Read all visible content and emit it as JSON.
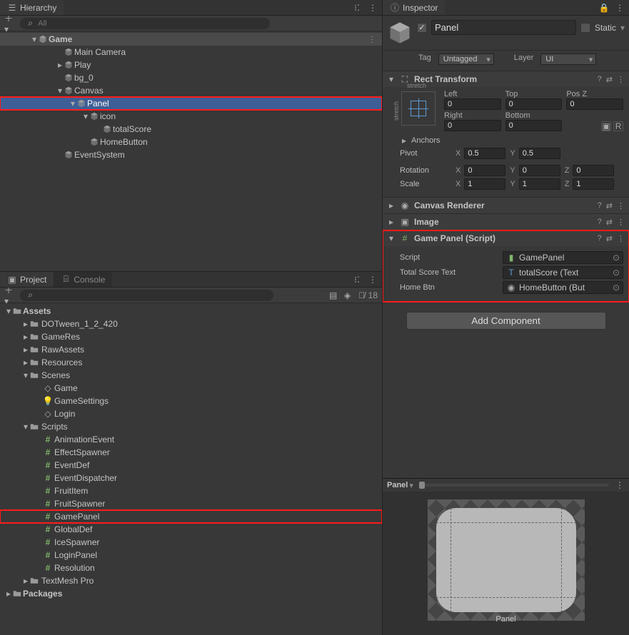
{
  "hierarchy": {
    "tab": "Hierarchy",
    "search_placeholder": "All",
    "scene": "Game",
    "items": [
      {
        "name": "Main Camera",
        "depth": 2,
        "fold": ""
      },
      {
        "name": "Play",
        "depth": 2,
        "fold": "▸"
      },
      {
        "name": "bg_0",
        "depth": 2,
        "fold": ""
      },
      {
        "name": "Canvas",
        "depth": 2,
        "fold": "▾"
      },
      {
        "name": "Panel",
        "depth": 3,
        "fold": "▾",
        "selected": true,
        "highlight": true
      },
      {
        "name": "icon",
        "depth": 4,
        "fold": "▾"
      },
      {
        "name": "totalScore",
        "depth": 5,
        "fold": ""
      },
      {
        "name": "HomeButton",
        "depth": 4,
        "fold": ""
      },
      {
        "name": "EventSystem",
        "depth": 2,
        "fold": ""
      }
    ]
  },
  "project": {
    "tab": "Project",
    "tab2": "Console",
    "visibility_count": "18",
    "root": "Assets",
    "folders": [
      {
        "name": "DOTween_1_2_420",
        "depth": 1,
        "fold": "▸",
        "icon": "folder"
      },
      {
        "name": "GameRes",
        "depth": 1,
        "fold": "▸",
        "icon": "folder"
      },
      {
        "name": "RawAssets",
        "depth": 1,
        "fold": "▸",
        "icon": "folder"
      },
      {
        "name": "Resources",
        "depth": 1,
        "fold": "▸",
        "icon": "folder"
      },
      {
        "name": "Scenes",
        "depth": 1,
        "fold": "▾",
        "icon": "folder"
      },
      {
        "name": "Game",
        "depth": 2,
        "fold": "",
        "icon": "scene"
      },
      {
        "name": "GameSettings",
        "depth": 2,
        "fold": "",
        "icon": "light"
      },
      {
        "name": "Login",
        "depth": 2,
        "fold": "",
        "icon": "scene"
      },
      {
        "name": "Scripts",
        "depth": 1,
        "fold": "▾",
        "icon": "folder"
      },
      {
        "name": "AnimationEvent",
        "depth": 2,
        "fold": "",
        "icon": "cs"
      },
      {
        "name": "EffectSpawner",
        "depth": 2,
        "fold": "",
        "icon": "cs"
      },
      {
        "name": "EventDef",
        "depth": 2,
        "fold": "",
        "icon": "cs"
      },
      {
        "name": "EventDispatcher",
        "depth": 2,
        "fold": "",
        "icon": "cs"
      },
      {
        "name": "FruitItem",
        "depth": 2,
        "fold": "",
        "icon": "cs"
      },
      {
        "name": "FruitSpawner",
        "depth": 2,
        "fold": "",
        "icon": "cs"
      },
      {
        "name": "GamePanel",
        "depth": 2,
        "fold": "",
        "icon": "cs",
        "highlight": true
      },
      {
        "name": "GlobalDef",
        "depth": 2,
        "fold": "",
        "icon": "cs"
      },
      {
        "name": "IceSpawner",
        "depth": 2,
        "fold": "",
        "icon": "cs"
      },
      {
        "name": "LoginPanel",
        "depth": 2,
        "fold": "",
        "icon": "cs"
      },
      {
        "name": "Resolution",
        "depth": 2,
        "fold": "",
        "icon": "cs"
      },
      {
        "name": "TextMesh Pro",
        "depth": 1,
        "fold": "▸",
        "icon": "folder"
      }
    ],
    "packages": "Packages"
  },
  "inspector": {
    "tab": "Inspector",
    "name": "Panel",
    "static": "Static",
    "tag_label": "Tag",
    "tag_value": "Untagged",
    "layer_label": "Layer",
    "layer_value": "UI",
    "rect": {
      "title": "Rect Transform",
      "stretch": "stretch",
      "left_l": "Left",
      "left_v": "0",
      "top_l": "Top",
      "top_v": "0",
      "posz_l": "Pos Z",
      "posz_v": "0",
      "right_l": "Right",
      "right_v": "0",
      "bottom_l": "Bottom",
      "bottom_v": "0",
      "anchors": "Anchors",
      "pivot": "Pivot",
      "pivot_x": "0.5",
      "pivot_y": "0.5",
      "rotation": "Rotation",
      "rot_x": "0",
      "rot_y": "0",
      "rot_z": "0",
      "scale": "Scale",
      "s_x": "1",
      "s_y": "1",
      "s_z": "1"
    },
    "canvas_renderer": "Canvas Renderer",
    "image": "Image",
    "gamepanel": {
      "title": "Game Panel (Script)",
      "script_l": "Script",
      "script_v": "GamePanel",
      "total_l": "Total Score Text",
      "total_v": "totalScore (Text",
      "home_l": "Home Btn",
      "home_v": "HomeButton (But"
    },
    "add_component": "Add Component",
    "preview_name": "Panel",
    "preview_caption": "Panel"
  }
}
